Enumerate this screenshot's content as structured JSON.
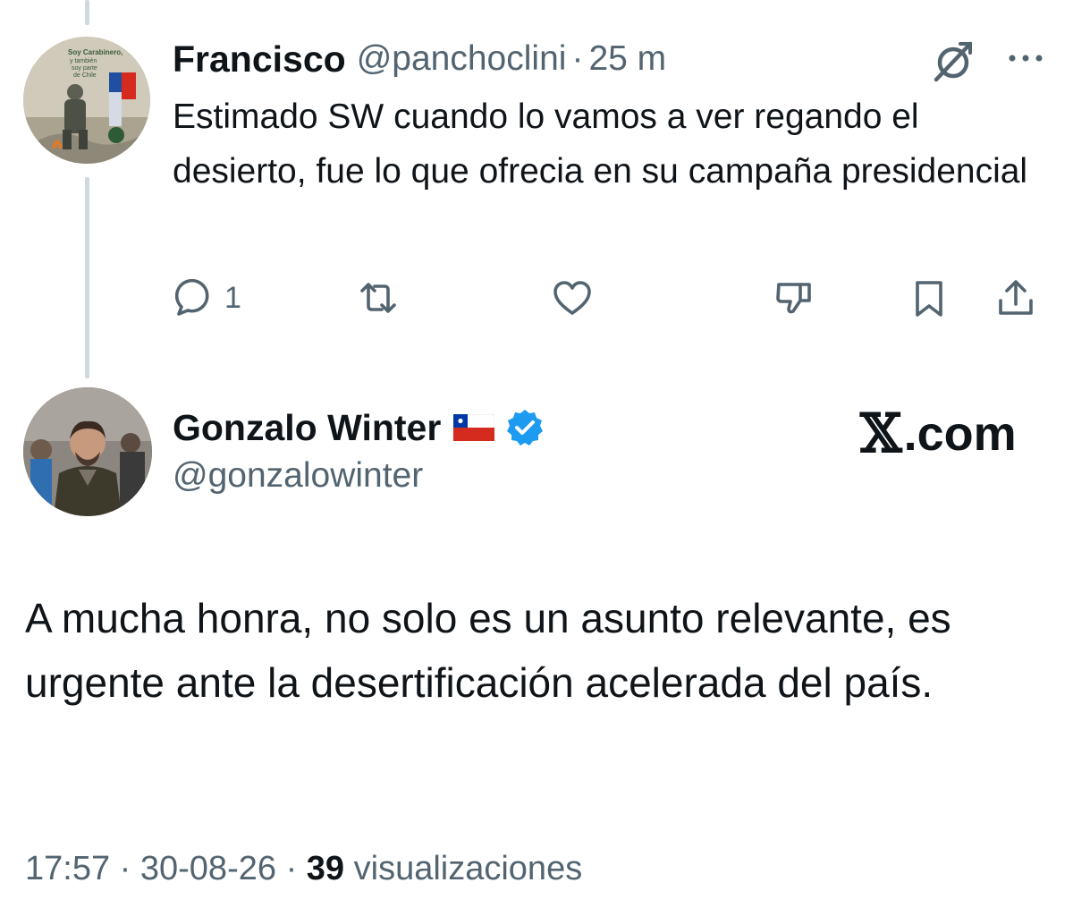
{
  "reply": {
    "name": "Francisco",
    "handle": "@panchoclini",
    "separator": "·",
    "time": "25 m",
    "text": "Estimado SW cuando lo vamos a ver regando el desierto, fue lo que ofrecia en su campaña presidencial",
    "avatar_text": "Soy Carabinero, y también soy parte de Chile",
    "reply_count": "1"
  },
  "main": {
    "name": "Gonzalo Winter",
    "handle": "@gonzalowinter",
    "text": "A mucha honra, no solo es un asunto relevante, es urgente ante la desertificación acelerada del país.",
    "time": "17:57",
    "separator": "·",
    "date": "30-08-26",
    "views_count": "39",
    "views_label": "visualizaciones"
  },
  "brand": {
    "x": "𝕏",
    "suffix": ".com"
  },
  "icons": {
    "grok": "grok-icon",
    "more": "more-icon",
    "reply": "reply-icon",
    "retweet": "retweet-icon",
    "like": "heart-icon",
    "downvote": "thumbs-down-icon",
    "bookmark": "bookmark-icon",
    "share": "share-icon",
    "verified": "verified-badge-icon",
    "flag": "chile-flag-icon"
  },
  "colors": {
    "text": "#0f1419",
    "secondary": "#536471",
    "verified": "#1d9bf0",
    "thread_line": "#cfd9de"
  }
}
